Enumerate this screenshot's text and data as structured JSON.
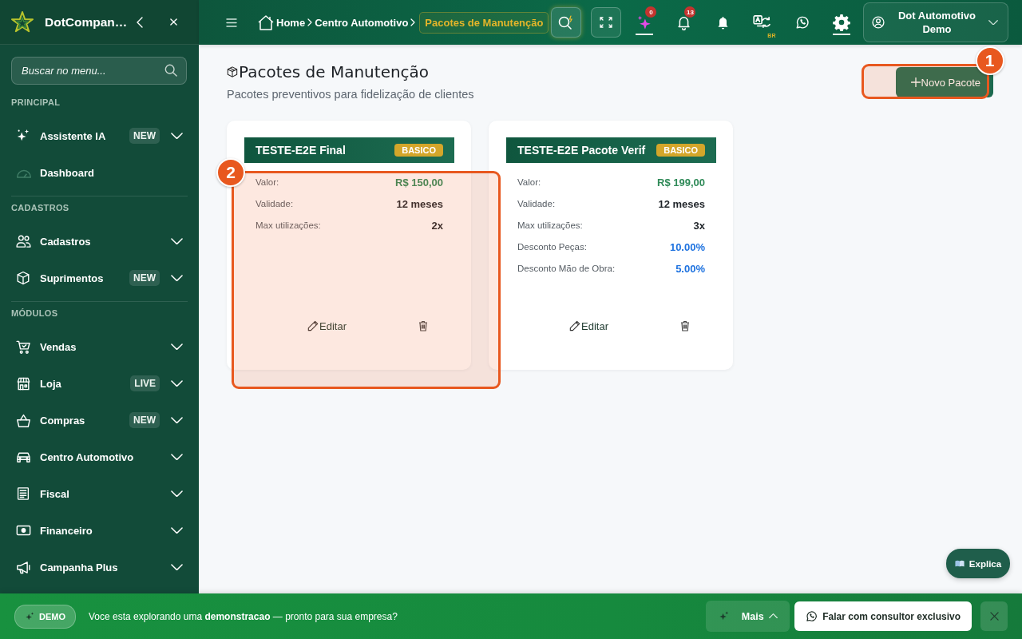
{
  "sidebar": {
    "brand": "DotCompan…",
    "search": {
      "placeholder": "Buscar no menu..."
    },
    "sections": [
      {
        "title": "PRINCIPAL",
        "items": [
          {
            "label": "Assistente IA",
            "kind": "group",
            "badge": "NEW",
            "expanded": false
          },
          {
            "label": "Dashboard",
            "kind": "link"
          }
        ]
      },
      {
        "title": "CADASTROS",
        "items": [
          {
            "label": "Cadastros",
            "kind": "group",
            "expanded": false
          },
          {
            "label": "Suprimentos",
            "kind": "group",
            "badge": "NEW",
            "expanded": false
          }
        ]
      },
      {
        "title": "MÓDULOS",
        "items": [
          {
            "label": "Vendas",
            "kind": "group",
            "expanded": false
          },
          {
            "label": "Loja",
            "kind": "group",
            "badge": "LIVE",
            "expanded": false
          },
          {
            "label": "Compras",
            "kind": "group",
            "badge": "NEW",
            "expanded": false
          },
          {
            "label": "Centro Automotivo",
            "kind": "group",
            "expanded": false
          },
          {
            "label": "Fiscal",
            "kind": "group",
            "expanded": false
          },
          {
            "label": "Financeiro",
            "kind": "group",
            "expanded": false
          },
          {
            "label": "Campanha Plus",
            "kind": "group",
            "expanded": false
          }
        ]
      }
    ]
  },
  "topbar": {
    "breadcrumbs": [
      {
        "label": "Home",
        "selected": false
      },
      {
        "label": "Centro Automotivo",
        "selected": false
      },
      {
        "label": "Pacotes de Manutenção",
        "selected": true
      }
    ],
    "tools": [
      {
        "badge": "0",
        "active": true
      },
      {
        "badge": "13",
        "active": false
      },
      {
        "active": false
      },
      {
        "tag": "BR",
        "active": false
      },
      {
        "active": false
      },
      {
        "active": true
      }
    ],
    "user": {
      "name": "Dot Automotivo Demo"
    }
  },
  "page": {
    "title": "Pacotes de Manutenção",
    "subtitle": "Pacotes preventivos para fidelização de clientes",
    "new_button": {
      "label": "Novo Pacote",
      "callout": "1"
    }
  },
  "cards": [
    {
      "name": "TESTE-E2E Final",
      "tier": "BASICO",
      "callout": "2",
      "fields": [
        {
          "label": "Valor:",
          "value": "R$ 150,00",
          "kind": "money"
        },
        {
          "label": "Validade:",
          "value": "12 meses",
          "kind": "text"
        },
        {
          "label": "Max utilizações:",
          "value": "2x",
          "kind": "text"
        }
      ],
      "edit": "Editar"
    },
    {
      "name": "TESTE-E2E Pacote Verif",
      "tier": "BASICO",
      "fields": [
        {
          "label": "Valor:",
          "value": "R$ 199,00",
          "kind": "money"
        },
        {
          "label": "Validade:",
          "value": "12 meses",
          "kind": "text"
        },
        {
          "label": "Max utilizações:",
          "value": "3x",
          "kind": "text"
        },
        {
          "label": "Desconto Peças:",
          "value": "10.00%",
          "kind": "percent"
        },
        {
          "label": "Desconto Mão de Obra:",
          "value": "5.00%",
          "kind": "percent"
        }
      ],
      "edit": "Editar"
    }
  ],
  "help_button": "Explica",
  "demo_bar": {
    "tag": "DEMO",
    "message": "Voce esta explorando uma **demonstracao** — pronto para sua empresa?",
    "more": "Mais",
    "cta": "Falar com consultor exclusivo"
  }
}
